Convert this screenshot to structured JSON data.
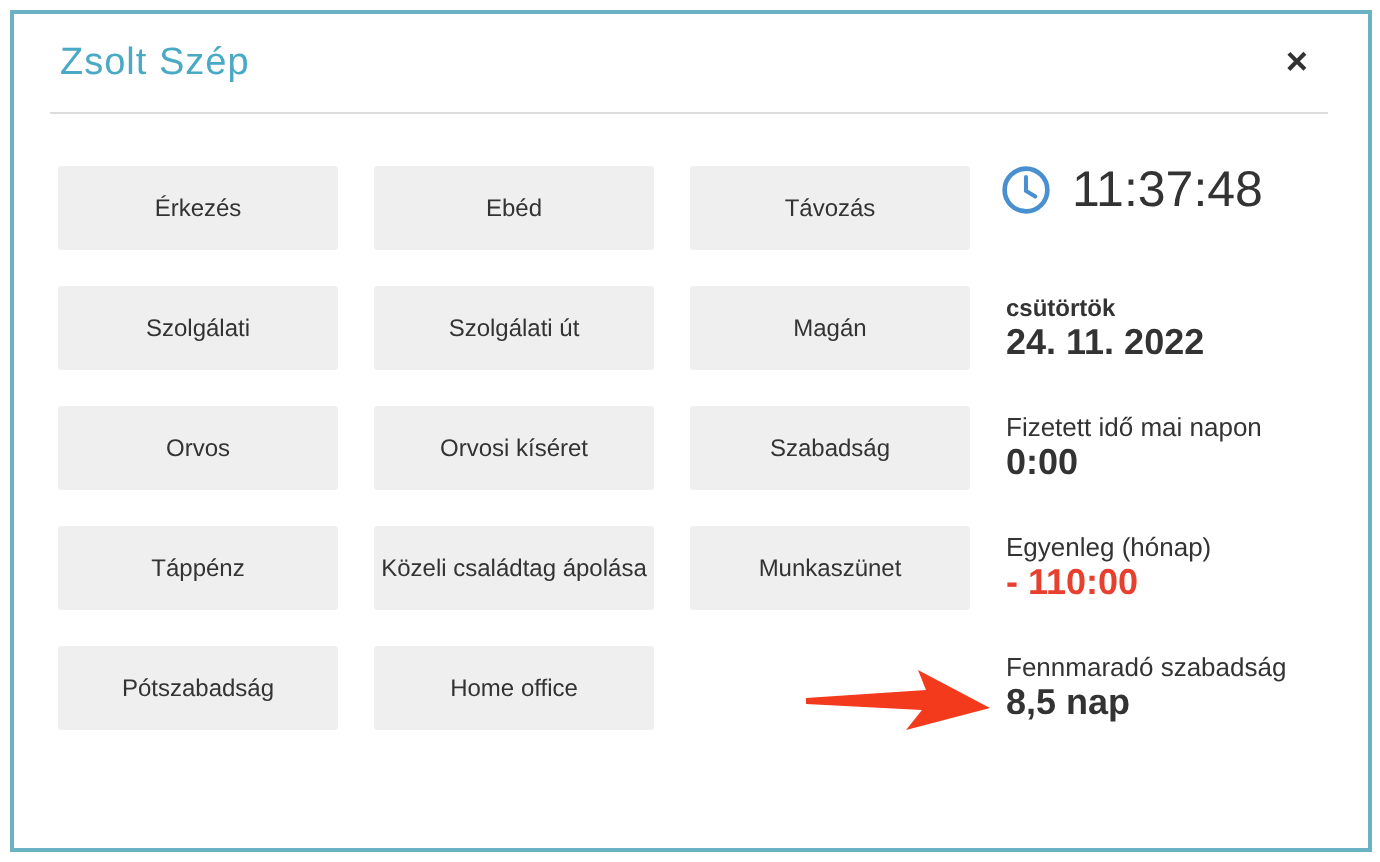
{
  "dialog": {
    "title": "Zsolt Szép",
    "close": "×"
  },
  "action_rows": [
    [
      "Érkezés",
      "Ebéd",
      "Távozás"
    ],
    [
      "Szolgálati",
      "Szolgálati út",
      "Magán"
    ],
    [
      "Orvos",
      "Orvosi kíséret",
      "Szabadság"
    ],
    [
      "Táppénz",
      "Közeli családtag ápolása",
      "Munkaszünet"
    ],
    [
      "Pótszabadság",
      "Home office"
    ]
  ],
  "clock": {
    "time": "11:37:48"
  },
  "stats": [
    {
      "kind": "date",
      "label": "csütörtök",
      "value": "24. 11. 2022"
    },
    {
      "kind": "plain",
      "label": "Fizetett idő mai napon",
      "value": "0:00"
    },
    {
      "kind": "negative",
      "label": "Egyenleg (hónap)",
      "value": "- 110:00"
    },
    {
      "kind": "plain",
      "label": "Fennmaradó szabadság",
      "value": "8,5 nap",
      "highlighted": true
    }
  ]
}
